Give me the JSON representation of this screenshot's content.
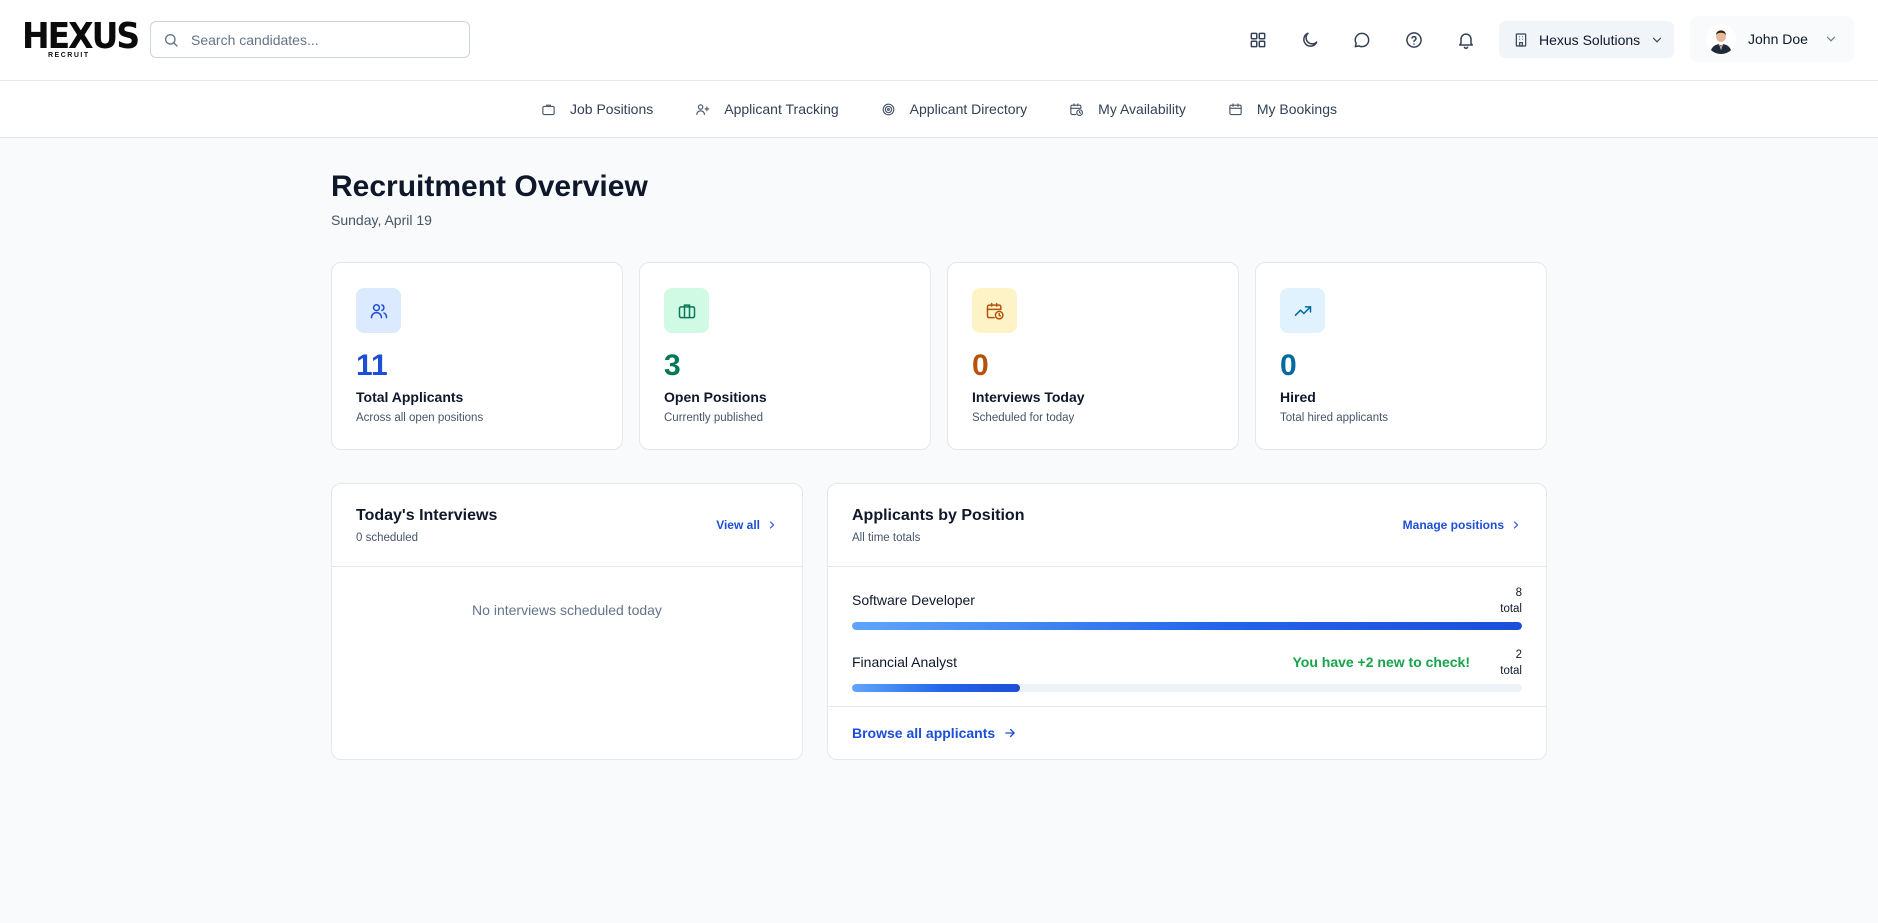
{
  "brand": {
    "logo_main": "HEXUS",
    "logo_sub": "RECRUIT"
  },
  "search": {
    "placeholder": "Search candidates..."
  },
  "header": {
    "icons": [
      "grid-icon",
      "moon-icon",
      "chat-icon",
      "help-icon",
      "bell-icon"
    ],
    "company": "Hexus Solutions",
    "user": "John Doe"
  },
  "nav": [
    {
      "label": "Job Positions",
      "icon": "briefcase-icon"
    },
    {
      "label": "Applicant Tracking",
      "icon": "user-plus-icon"
    },
    {
      "label": "Applicant Directory",
      "icon": "target-icon"
    },
    {
      "label": "My Availability",
      "icon": "calendar-clock-icon"
    },
    {
      "label": "My Bookings",
      "icon": "calendar-icon"
    }
  ],
  "page": {
    "title": "Recruitment Overview",
    "date": "Sunday, April 19"
  },
  "stats": [
    {
      "value": "11",
      "label": "Total Applicants",
      "sub": "Across all open positions",
      "icon": "users-icon",
      "color": "#1d4ed8",
      "bg": "#dbeafe"
    },
    {
      "value": "3",
      "label": "Open Positions",
      "sub": "Currently published",
      "icon": "briefcase-icon",
      "color": "#047857",
      "bg": "#d1fae5"
    },
    {
      "value": "0",
      "label": "Interviews Today",
      "sub": "Scheduled for today",
      "icon": "calendar-clock-icon",
      "color": "#b45309",
      "bg": "#fef3c7"
    },
    {
      "value": "0",
      "label": "Hired",
      "sub": "Total hired applicants",
      "icon": "trending-up-icon",
      "color": "#0369a1",
      "bg": "#e0f2fe"
    }
  ],
  "interviews": {
    "title": "Today's Interviews",
    "subtitle": "0 scheduled",
    "link": "View all",
    "empty": "No interviews scheduled today"
  },
  "positions": {
    "title": "Applicants by Position",
    "subtitle": "All time totals",
    "link": "Manage positions",
    "rows": [
      {
        "name": "Software Developer",
        "count": "8",
        "unit": "total",
        "note": "",
        "fraction": 1.0
      },
      {
        "name": "Financial Analyst",
        "count": "2",
        "unit": "total",
        "note": "You have +2 new to check!",
        "fraction": 0.25
      }
    ],
    "browse": "Browse all applicants"
  }
}
